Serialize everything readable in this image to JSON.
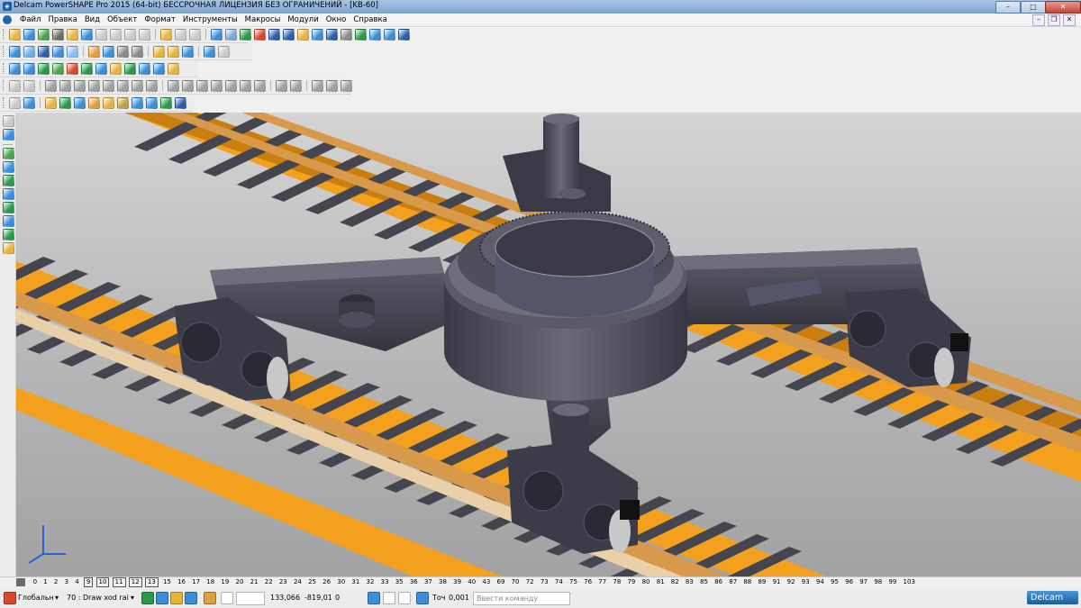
{
  "window": {
    "title": "Delcam PowerSHAPE Pro 2015 (64-bit) БЕССРОЧНАЯ ЛИЦЕНЗИЯ БЕЗ ОГРАНИЧЕНИЙ - [KB-60]",
    "minimize": "–",
    "maximize": "□",
    "close": "✕"
  },
  "menu": {
    "items": [
      "Файл",
      "Правка",
      "Вид",
      "Объект",
      "Формат",
      "Инструменты",
      "Макросы",
      "Модули",
      "Окно",
      "Справка"
    ]
  },
  "mdi_controls": [
    "–",
    "❐",
    "✕"
  ],
  "toolbars": {
    "rows": [
      [
        "#e7b43c",
        "#3a8fd8",
        "#4da34f",
        "#6d6d6d",
        "#e7b43c",
        "#3a8fd8",
        "#c9c9c9",
        "#c9c9c9",
        "#c9c9c9",
        "#c9c9c9",
        "sep",
        "#e7b43c",
        "#c9c9c9",
        "#c9c9c9",
        "sep",
        "#3a8fd8",
        "#7fa8d6",
        "#2a9a4a",
        "#d9482c",
        "#2d5fa8",
        "#2d5fa8",
        "#e7b43c",
        "#3a8fd8",
        "#2d5fa8",
        "#8a8a8a",
        "#2a9a4a",
        "#3a8fd8",
        "#3a8fd8",
        "#2d5fa8"
      ],
      [
        "#3a8fd8",
        "#6fb0e8",
        "#2d5fa8",
        "#3a8fd8",
        "#8cc0ee",
        "sep",
        "#e0a040",
        "#3a8fd8",
        "#8a8a8a",
        "#8a8a8a",
        "sep",
        "#e7b43c",
        "#e7b43c",
        "#3a8fd8",
        "sep",
        "#3a8fd8",
        "#c9c9c9"
      ],
      [
        "#3a8fd8",
        "#3a8fd8",
        "#2a9a4a",
        "#4da34f",
        "#d9482c",
        "#2a9a4a",
        "#3a8fd8",
        "#e7b43c",
        "#2a9a4a",
        "#3a8fd8",
        "#3a8fd8",
        "#e7b43c"
      ],
      [
        "#c9c9c9",
        "#c9c9c9",
        "sep",
        "#a0a0a0",
        "#a0a0a0",
        "#a0a0a0",
        "#a0a0a0",
        "#a0a0a0",
        "#a0a0a0",
        "#a0a0a0",
        "#a0a0a0",
        "sep",
        "#a0a0a0",
        "#a0a0a0",
        "#a0a0a0",
        "#a0a0a0",
        "#a0a0a0",
        "#a0a0a0",
        "#a0a0a0",
        "sep",
        "#a0a0a0",
        "#a0a0a0",
        "sep",
        "#a0a0a0",
        "#a0a0a0",
        "#a0a0a0"
      ],
      [
        "#c9c9c9",
        "#3a8fd8",
        "sep",
        "#e7b43c",
        "#2a9a4a",
        "#3a8fd8",
        "#e0a040",
        "#e7b43c",
        "#c0a040",
        "#3a8fd8",
        "#3a8fd8",
        "#2a9a4a",
        "#2d5fa8"
      ]
    ],
    "side": [
      "#c9c9c9",
      "#3a8fd8",
      "sep",
      "#4da34f",
      "#3a8fd8",
      "#2a9a4a",
      "#3a8fd8",
      "#2a9a4a",
      "#3a8fd8",
      "#2a9a4a",
      "#e7b43c"
    ]
  },
  "scene": {
    "background_top": "#d4d4d4",
    "background_bottom": "#a2a2a2",
    "model_color": "#4a4a5a",
    "beam_color": "#f2a01e",
    "rail_color": "#d89a4a",
    "sleeper_color": "#45454f"
  },
  "levels": {
    "items": [
      "0",
      "1",
      "2",
      "3",
      "4",
      "9",
      "10",
      "11",
      "12",
      "13",
      "15",
      "16",
      "17",
      "18",
      "19",
      "20",
      "21",
      "22",
      "23",
      "24",
      "25",
      "26",
      "30",
      "31",
      "32",
      "33",
      "35",
      "36",
      "37",
      "38",
      "39",
      "40",
      "43",
      "69",
      "70",
      "72",
      "73",
      "74",
      "75",
      "76",
      "77",
      "78",
      "79",
      "80",
      "81",
      "82",
      "83",
      "85",
      "86",
      "87",
      "88",
      "89",
      "91",
      "92",
      "93",
      "94",
      "95",
      "96",
      "97",
      "98",
      "99",
      "103"
    ],
    "active": [
      "9",
      "10",
      "11",
      "12",
      "13"
    ]
  },
  "status": {
    "workplane": "Глобальн",
    "level_value": "70  : Draw xod rai",
    "coord_x": "133,066",
    "coord_y": "-819,01",
    "coord_z": "0",
    "tolerance_label": "Точ",
    "tolerance_value": "0,001",
    "command_placeholder": "Ввести команду",
    "brand": "Delcam"
  }
}
